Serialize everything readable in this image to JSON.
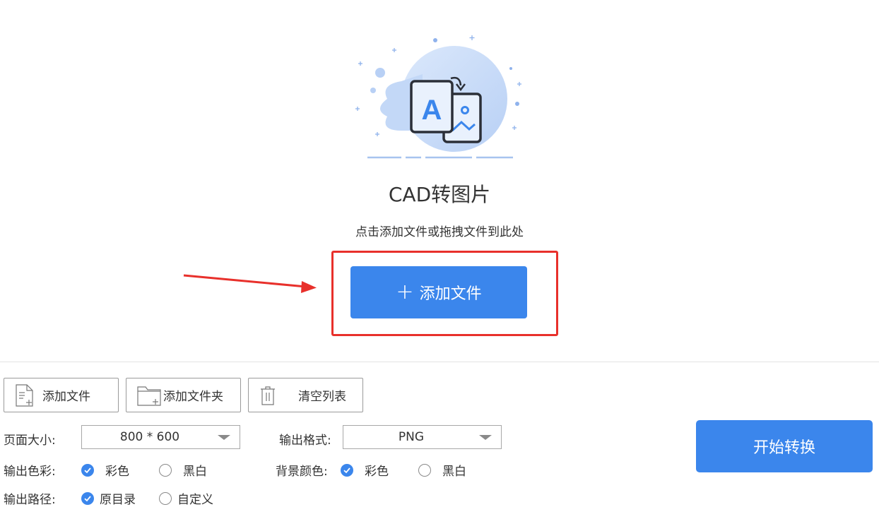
{
  "hero": {
    "title": "CAD转图片",
    "subtitle": "点击添加文件或拖拽文件到此处",
    "add_file_label": "添加文件",
    "plus_glyph": "+",
    "illustration_letter": "A"
  },
  "toolbar": {
    "add_file": "添加文件",
    "add_folder": "添加文件夹",
    "clear_list": "清空列表"
  },
  "settings": {
    "page_size": {
      "label": "页面大小:",
      "value": "800 * 600"
    },
    "output_format": {
      "label": "输出格式:",
      "value": "PNG"
    },
    "output_color": {
      "label": "输出色彩:",
      "options": [
        "彩色",
        "黑白"
      ],
      "selected": "彩色"
    },
    "background_color": {
      "label": "背景颜色:",
      "options": [
        "彩色",
        "黑白"
      ],
      "selected": "彩色"
    },
    "output_path": {
      "label": "输出路径:",
      "options": [
        "原目录",
        "自定义"
      ],
      "selected": "原目录"
    }
  },
  "start_button": "开始转换",
  "colors": {
    "accent": "#3b86ec",
    "highlight": "#e8302b",
    "illustration_blue": "#c9dcf8"
  },
  "icons": {
    "add_file": "file-add-icon",
    "add_folder": "folder-add-icon",
    "clear": "trash-icon",
    "radio_checked": "check-circle-icon"
  }
}
